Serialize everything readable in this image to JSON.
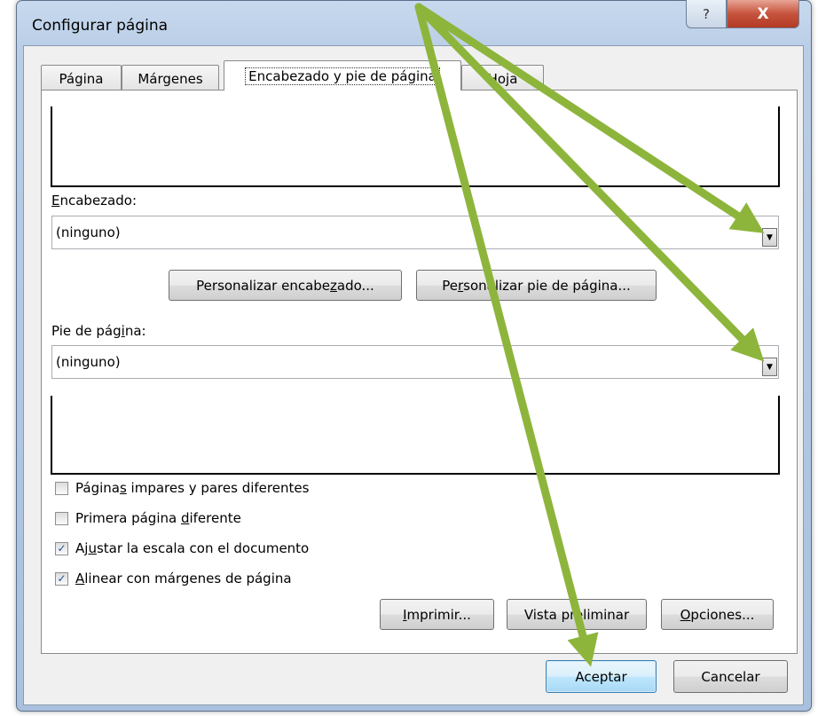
{
  "window": {
    "title": "Configurar página",
    "help_glyph": "?",
    "close_glyph": "X"
  },
  "tabs": [
    {
      "label": "Página"
    },
    {
      "label": "Márgenes"
    },
    {
      "label": "Encabezado y pie de página"
    },
    {
      "label": "Hoja"
    }
  ],
  "header": {
    "label_first": "E",
    "label_rest": "ncabezado:",
    "value": "(ninguno)"
  },
  "footer": {
    "label_pre": "Pie de pág",
    "label_u": "i",
    "label_post": "na:",
    "value": "(ninguno)"
  },
  "custom_buttons": {
    "header_pre": "Personalizar encabe",
    "header_u": "z",
    "header_post": "ado...",
    "footer_pre": "Pe",
    "footer_u": "r",
    "footer_post": "sonalizar pie de página..."
  },
  "options": [
    {
      "pre": "Página",
      "u": "s",
      "post": " impares y pares diferentes",
      "checked": false
    },
    {
      "pre": "Primera página ",
      "u": "d",
      "post": "iferente",
      "checked": false
    },
    {
      "pre": "Aj",
      "u": "u",
      "post": "star la escala con el documento",
      "checked": true
    },
    {
      "pre": "",
      "u": "A",
      "post": "linear con márgenes de página",
      "checked": true
    }
  ],
  "check_glyph": "✓",
  "action_buttons": {
    "print_u": "I",
    "print_rest": "mprimir...",
    "preview": "Vista preliminar",
    "options_u": "O",
    "options_rest": "pciones..."
  },
  "dialog_buttons": {
    "ok": "Aceptar",
    "cancel": "Cancelar"
  },
  "combo_arrow_glyph": "▼",
  "colors": {
    "annotation_arrow": "#8db53c",
    "default_button_border": "#3c7fb1",
    "close_button": "#c6533e"
  }
}
